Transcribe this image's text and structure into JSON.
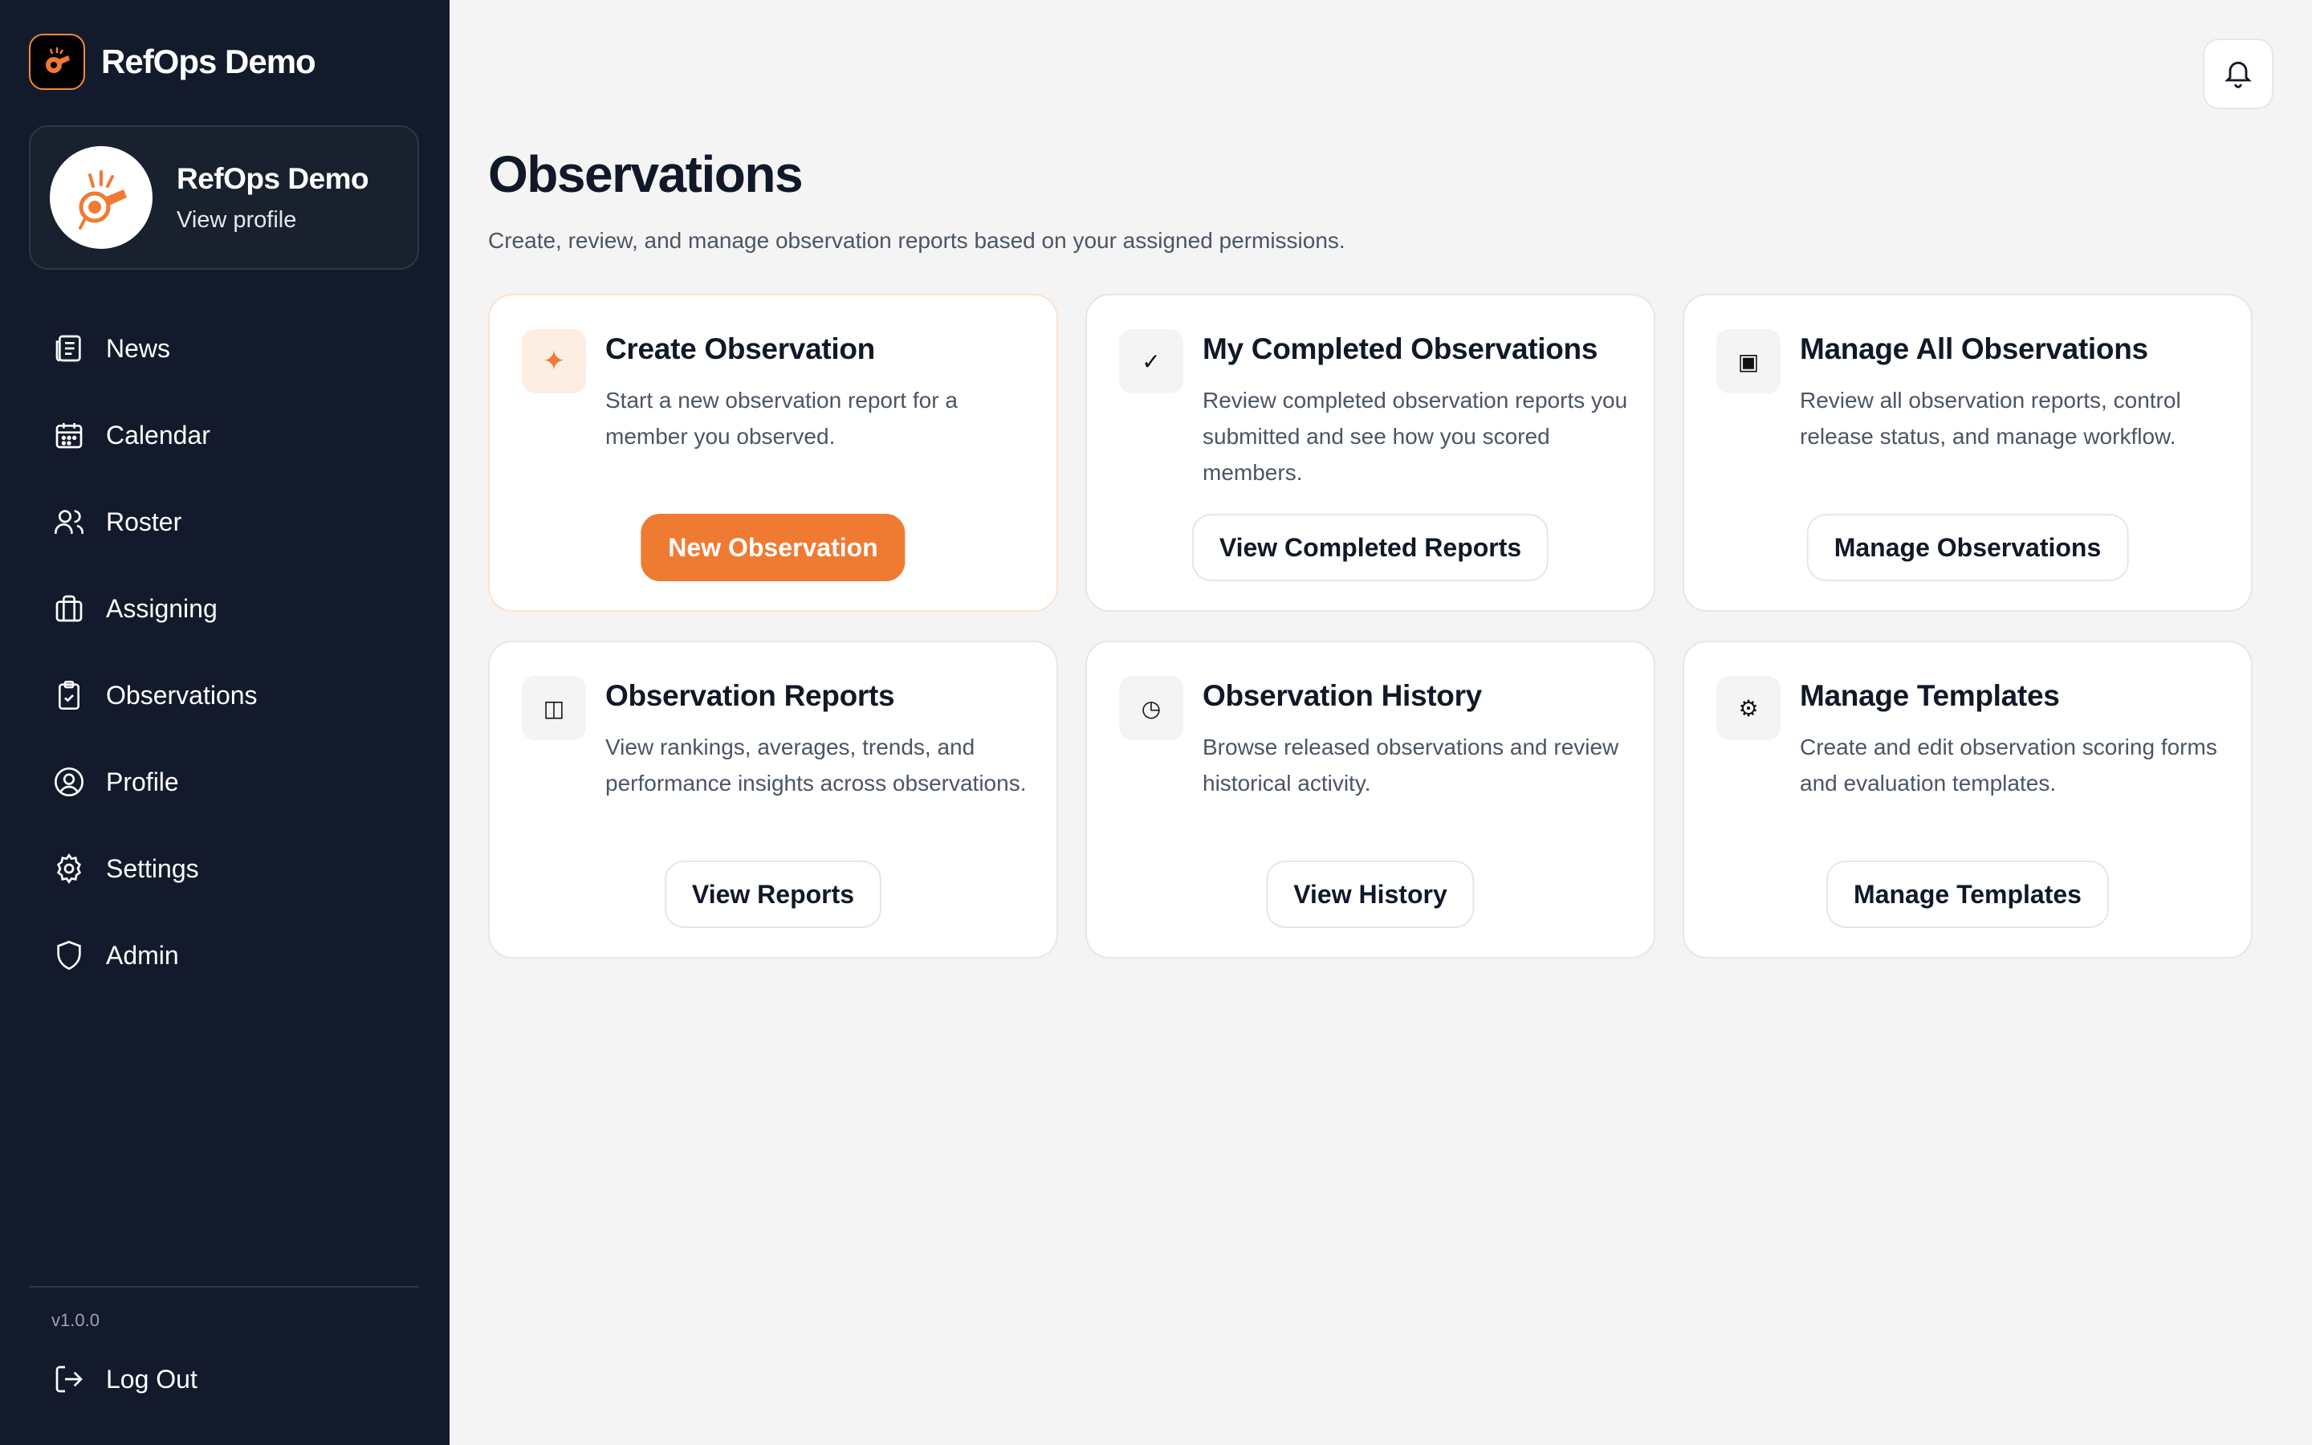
{
  "app": {
    "name": "RefOps Demo"
  },
  "profile": {
    "name": "RefOps Demo",
    "link": "View profile"
  },
  "nav": {
    "items": [
      {
        "label": "News",
        "icon": "newspaper-icon"
      },
      {
        "label": "Calendar",
        "icon": "calendar-icon"
      },
      {
        "label": "Roster",
        "icon": "users-icon"
      },
      {
        "label": "Assigning",
        "icon": "briefcase-icon"
      },
      {
        "label": "Observations",
        "icon": "clipboard-check-icon"
      },
      {
        "label": "Profile",
        "icon": "user-circle-icon"
      },
      {
        "label": "Settings",
        "icon": "gear-icon"
      },
      {
        "label": "Admin",
        "icon": "shield-icon"
      }
    ]
  },
  "footer": {
    "version": "v1.0.0",
    "logout": "Log Out"
  },
  "page": {
    "title": "Observations",
    "subtitle": "Create, review, and manage observation reports based on your assigned permissions."
  },
  "cards": [
    {
      "icon": "sparkle-icon",
      "glyph": "✦",
      "title": "Create Observation",
      "desc": "Start a new observation report for a member you observed.",
      "button": "New Observation"
    },
    {
      "icon": "checkmark-icon",
      "glyph": "✓",
      "title": "My Completed Observations",
      "desc": "Review completed observation reports you submitted and see how you scored members.",
      "button": "View Completed Reports"
    },
    {
      "icon": "square-icon",
      "glyph": "▣",
      "title": "Manage All Observations",
      "desc": "Review all observation reports, control release status, and manage workflow.",
      "button": "Manage Observations"
    },
    {
      "icon": "columns-icon",
      "glyph": "◫",
      "title": "Observation Reports",
      "desc": "View rankings, averages, trends, and performance insights across observations.",
      "button": "View Reports"
    },
    {
      "icon": "clock-icon",
      "glyph": "◷",
      "title": "Observation History",
      "desc": "Browse released observations and review historical activity.",
      "button": "View History"
    },
    {
      "icon": "gear-icon",
      "glyph": "⚙",
      "title": "Manage Templates",
      "desc": "Create and edit observation scoring forms and evaluation templates.",
      "button": "Manage Templates"
    }
  ],
  "colors": {
    "sidebar": "#131a2b",
    "accent": "#ef7a32",
    "background": "#f4f4f4"
  }
}
